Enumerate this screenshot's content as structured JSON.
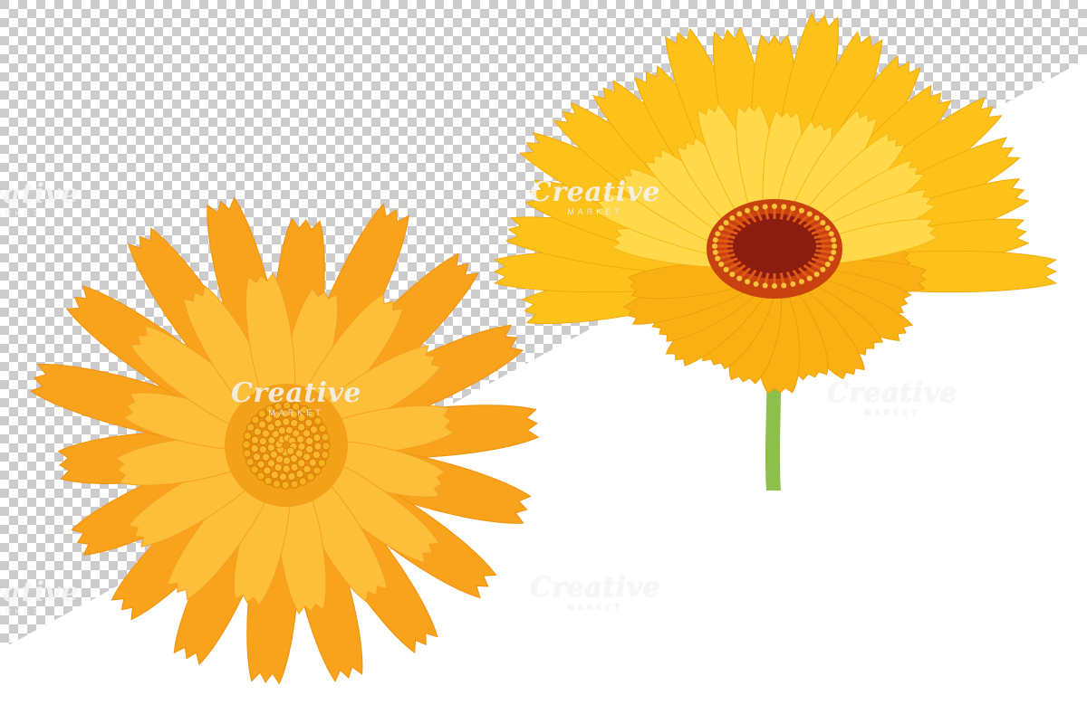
{
  "watermark": {
    "brand": "Creative",
    "sub": "MARKET"
  },
  "colors": {
    "checker_dark": "#cccccc",
    "checker_light": "#ffffff",
    "orange_petal": "#f9a21b",
    "orange_petal_light": "#fdbf3a",
    "yellow_petal": "#fcc21a",
    "yellow_petal_light": "#ffd94a",
    "orange_center": "#e8900f",
    "red_center": "#8a1d0f",
    "stem": "#8cc04a"
  },
  "objects": [
    "orange-marigold-flower-top-view",
    "yellow-marigold-flower-side-view"
  ]
}
